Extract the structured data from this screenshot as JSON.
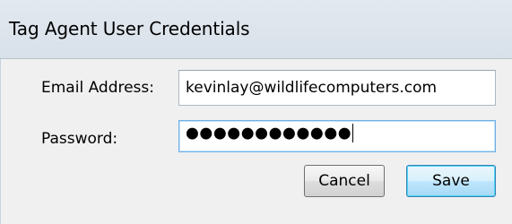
{
  "window": {
    "title": "Tag Agent User Credentials"
  },
  "form": {
    "email_label": "Email Address:",
    "email_value": "kevinlay@wildlifecomputers.com",
    "password_label": "Password:",
    "password_masked": "●●●●●●●●●●●●"
  },
  "buttons": {
    "cancel_label": "Cancel",
    "save_label": "Save"
  }
}
